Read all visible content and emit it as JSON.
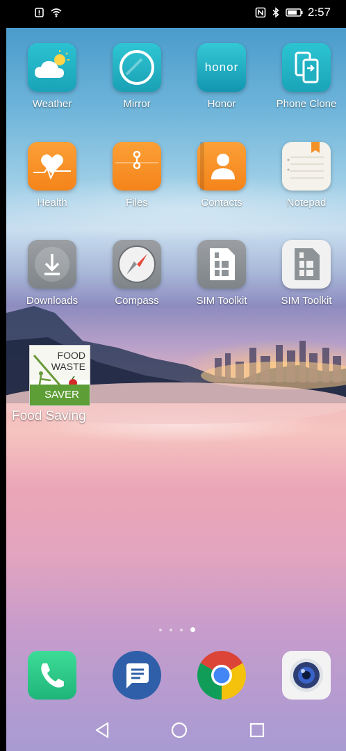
{
  "status_bar": {
    "time": "2:57",
    "left_icons": [
      "alert-icon",
      "wifi-icon"
    ],
    "right_icons": [
      "nfc-icon",
      "bluetooth-icon",
      "battery-icon"
    ]
  },
  "home": {
    "apps": [
      {
        "label": "Weather",
        "icon": "weather-icon"
      },
      {
        "label": "Mirror",
        "icon": "mirror-icon"
      },
      {
        "label": "Honor",
        "icon": "honor-icon",
        "icon_text": "honor"
      },
      {
        "label": "Phone Clone",
        "icon": "phone-clone-icon"
      },
      {
        "label": "Health",
        "icon": "health-icon"
      },
      {
        "label": "Files",
        "icon": "files-icon"
      },
      {
        "label": "Contacts",
        "icon": "contacts-icon"
      },
      {
        "label": "Notepad",
        "icon": "notepad-icon"
      },
      {
        "label": "Downloads",
        "icon": "downloads-icon"
      },
      {
        "label": "Compass",
        "icon": "compass-icon"
      },
      {
        "label": "SIM Toolkit",
        "icon": "sim-toolkit-icon"
      },
      {
        "label": "SIM Toolkit",
        "icon": "sim-toolkit-icon"
      },
      {
        "label": "Food Saving",
        "icon": "food-waste-saver-icon",
        "icon_text": [
          "FOOD",
          "WASTE",
          "SAVER"
        ]
      }
    ],
    "page_indicator": {
      "pages": 4,
      "current": 4
    }
  },
  "dock": {
    "apps": [
      {
        "icon": "phone-icon"
      },
      {
        "icon": "messages-icon"
      },
      {
        "icon": "chrome-icon"
      },
      {
        "icon": "camera-icon"
      }
    ]
  },
  "nav_bar": {
    "buttons": [
      "back-icon",
      "home-icon",
      "recents-icon"
    ]
  },
  "colors": {
    "orange": "#f9962a",
    "teal": "#1fb7c6",
    "gray": "#8e9397",
    "status_bar": "#000000"
  }
}
